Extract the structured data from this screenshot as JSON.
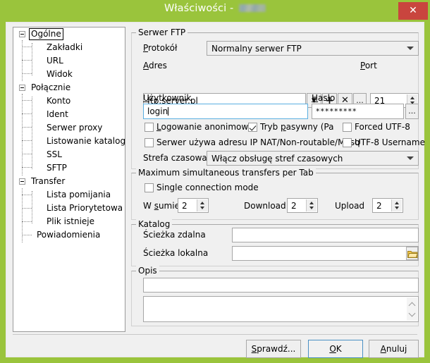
{
  "window": {
    "title_prefix": "Właściwości - ",
    "title_redacted": true,
    "close_label": "✕",
    "accent_color": "#9ac43c",
    "close_color": "#c9453e",
    "body_color": "#f0f0f0"
  },
  "tree": {
    "nodes": [
      {
        "label": "Ogólne",
        "level": 0,
        "expander": "minus",
        "selected": true
      },
      {
        "label": "Zakładki",
        "level": 1,
        "expander": "none",
        "selected": false
      },
      {
        "label": "URL",
        "level": 1,
        "expander": "none",
        "selected": false
      },
      {
        "label": "Widok",
        "level": 1,
        "expander": "none",
        "selected": false
      },
      {
        "label": "Połącznie",
        "level": 0,
        "expander": "minus",
        "selected": false
      },
      {
        "label": "Konto",
        "level": 1,
        "expander": "none",
        "selected": false
      },
      {
        "label": "Ident",
        "level": 1,
        "expander": "none",
        "selected": false
      },
      {
        "label": "Serwer proxy",
        "level": 1,
        "expander": "none",
        "selected": false
      },
      {
        "label": "Listowanie katalogów",
        "level": 1,
        "expander": "none",
        "selected": false
      },
      {
        "label": "SSL",
        "level": 1,
        "expander": "none",
        "selected": false
      },
      {
        "label": "SFTP",
        "level": 1,
        "expander": "none",
        "selected": false
      },
      {
        "label": "Transfer",
        "level": 0,
        "expander": "minus",
        "selected": false
      },
      {
        "label": "Lista pomijania",
        "level": 1,
        "expander": "none",
        "selected": false
      },
      {
        "label": "Lista Priorytetowa",
        "level": 1,
        "expander": "none",
        "selected": false
      },
      {
        "label": "Plik istnieje",
        "level": 1,
        "expander": "none",
        "selected": false
      },
      {
        "label": "Powiadomienia",
        "level": 0,
        "expander": "none",
        "selected": false
      }
    ]
  },
  "ftp_group": {
    "title": "Serwer FTP",
    "protocol_label": "Protokół",
    "protocol_value": "Normalny serwer FTP",
    "address_label": "Adres",
    "address_value": "ftp.server.pl",
    "address_dropdown_icon": "chevron-down-icon",
    "address_add_icon": "plus-icon",
    "address_delete_icon": "cross-icon",
    "address_more_label": "...",
    "port_label": "Port",
    "port_value": "21",
    "username_label": "Użytkownik",
    "username_value": "login",
    "password_label": "Hasło",
    "password_value": "*********",
    "password_more_label": "...",
    "anonymous_label": "Logowanie anonimowe",
    "anonymous_checked": false,
    "passive_label": "Tryb pasywny (Pa",
    "passive_checked": true,
    "forced_utf8_label": "Forced UTF-8",
    "forced_utf8_checked": false,
    "nat_label": "Serwer używa adresu IP NAT/Non-routable/Masq",
    "nat_checked": false,
    "utf8_username_label": "UTF-8 Username",
    "utf8_username_checked": false,
    "timezone_label": "Strefa czasowa",
    "timezone_value": "Włącz obsługę stref czasowych"
  },
  "transfers_group": {
    "title": "Maximum simultaneous transfers per Tab",
    "single_connection_label": "Single connection mode",
    "single_connection_checked": false,
    "total_label": "W sumie",
    "total_value": "2",
    "download_label": "Download",
    "download_value": "2",
    "upload_label": "Upload",
    "upload_value": "2"
  },
  "directory_group": {
    "title": "Katalog",
    "remote_label": "Ścieżka zdalna",
    "remote_value": "",
    "local_label": "Ścieżka lokalna",
    "local_value": "",
    "browse_icon": "folder-icon"
  },
  "description_group": {
    "title": "Opis",
    "line_value": "",
    "area_value": ""
  },
  "buttons": {
    "check": "Sprawdź...",
    "ok": "OK",
    "cancel": "Anuluj"
  }
}
